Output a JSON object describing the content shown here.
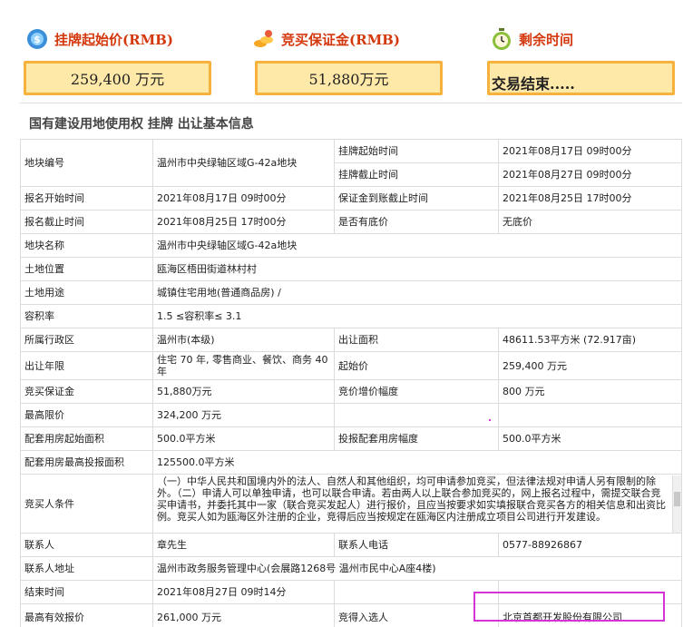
{
  "stats": {
    "start_price": {
      "title": "挂牌起始价(RMB)",
      "value": "259,400  万元",
      "icon": "money-bag-icon"
    },
    "deposit": {
      "title": "竞买保证金(RMB)",
      "value": "51,880万元",
      "icon": "coins-icon"
    },
    "remaining": {
      "title": "剩余时间",
      "value": "交易结束.....",
      "icon": "timer-icon"
    }
  },
  "section_title": "国有建设用地使用权 挂牌 出让基本信息",
  "fields": {
    "plot_no": {
      "label": "地块编号",
      "value": "温州市中央绿轴区域G-42a地块"
    },
    "listing_start": {
      "label": "挂牌起始时间",
      "value": "2021年08月17日 09时00分"
    },
    "listing_end": {
      "label": "挂牌截止时间",
      "value": "2021年08月27日 09时00分"
    },
    "reg_start": {
      "label": "报名开始时间",
      "value": "2021年08月17日 09时00分"
    },
    "deposit_deadline": {
      "label": "保证金到账截止时间",
      "value": "2021年08月25日 17时00分"
    },
    "reg_end": {
      "label": "报名截止时间",
      "value": "2021年08月25日 17时00分"
    },
    "reserve": {
      "label": "是否有底价",
      "value": "无底价"
    },
    "plot_name": {
      "label": "地块名称",
      "value": "温州市中央绿轴区域G-42a地块"
    },
    "location": {
      "label": "土地位置",
      "value": "瓯海区梧田街道林村村"
    },
    "usage": {
      "label": "土地用途",
      "value": "城镇住宅用地(普通商品房) /"
    },
    "far": {
      "label": "容积率",
      "value": "1.5 ≤容积率≤ 3.1"
    },
    "district": {
      "label": "所属行政区",
      "value": "温州市(本级)"
    },
    "area": {
      "label": "出让面积",
      "value": "48611.53平方米 (72.917亩)"
    },
    "term": {
      "label": "出让年限",
      "value": "住宅 70 年, 零售商业、餐饮、商务 40年"
    },
    "start_price": {
      "label": "起始价",
      "value": "259,400 万元"
    },
    "bid_deposit": {
      "label": "竞买保证金",
      "value": "51,880万元"
    },
    "increment": {
      "label": "竞价增价幅度",
      "value": "800 万元"
    },
    "cap": {
      "label": "最高限价",
      "value": "324,200 万元"
    },
    "supp_start": {
      "label": "配套用房起始面积",
      "value": "500.0平方米"
    },
    "supp_step": {
      "label": "投报配套用房幅度",
      "value": "500.0平方米"
    },
    "supp_max": {
      "label": "配套用房最高投报面积",
      "value": "125500.0平方米"
    },
    "conditions": {
      "label": "竞买人条件",
      "value": "（一）中华人民共和国境内外的法人、自然人和其他组织，均可申请参加竞买，但法律法规对申请人另有限制的除外。（二）申请人可以单独申请，也可以联合申请。若由两人以上联合参加竞买的，网上报名过程中，需提交联合竞买申请书，并委托其中一家（联合竞买发起人）进行报价，且应当按要求如实填报联合竞买各方的相关信息和出资比例。竞买人如为瓯海区外注册的企业，竞得后应当按规定在瓯海区内注册成立项目公司进行开发建设。"
    },
    "contact": {
      "label": "联系人",
      "value": "章先生"
    },
    "phone": {
      "label": "联系人电话",
      "value": "0577-88926867"
    },
    "address": {
      "label": "联系人地址",
      "value": "温州市政务服务管理中心(会展路1268号 温州市民中心A座4楼)"
    },
    "end_time": {
      "label": "结束时间",
      "value": "2021年08月27日 09时14分"
    },
    "top_bid": {
      "label": "最高有效报价",
      "value": "261,000 万元"
    },
    "winner": {
      "label": "竞得入选人",
      "value": "北京首都开发股份有限公司"
    }
  },
  "colors": {
    "title_red": "#d4380d",
    "box_fill": "#ffe9a8",
    "box_border": "#f6b23c",
    "highlight": "#d633d6"
  }
}
